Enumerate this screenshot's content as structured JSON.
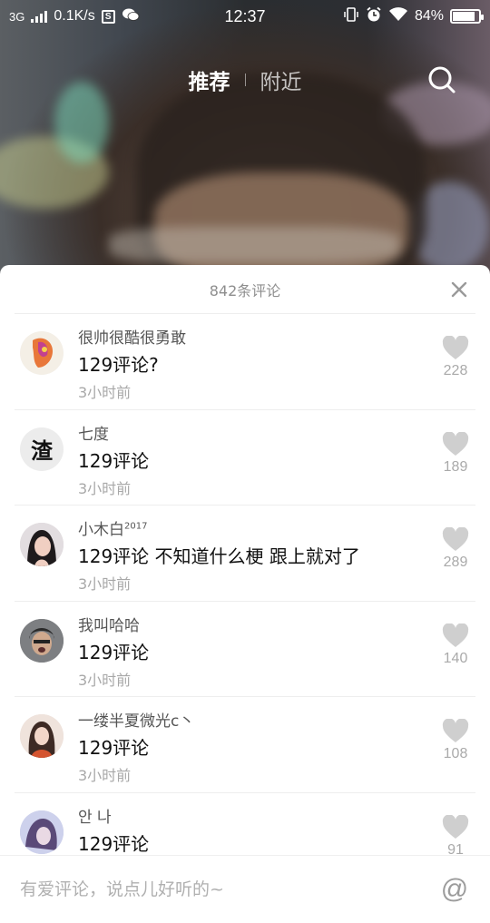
{
  "status_bar": {
    "network": "3G",
    "speed": "0.1K/s",
    "time": "12:37",
    "battery": "84%",
    "battery_level": 0.84,
    "icons": [
      "signal-icon",
      "s-box-icon",
      "wechat-icon",
      "vibrate-icon",
      "alarm-icon",
      "wifi-icon",
      "battery-icon"
    ]
  },
  "tabs": [
    {
      "label": "推荐",
      "active": true
    },
    {
      "label": "附近",
      "active": false
    }
  ],
  "comments_panel": {
    "title": "842条评论",
    "input_placeholder": "有爱评论，说点儿好听的~",
    "at_symbol": "@"
  },
  "comments": [
    {
      "username": "很帅很酷很勇敢",
      "sup": "",
      "text": "129评论?",
      "time": "3小时前",
      "likes": "228",
      "avatar": "orange-art"
    },
    {
      "username": "七度",
      "sup": "",
      "text": "129评论",
      "time": "3小时前",
      "likes": "189",
      "avatar": "text",
      "avatar_text": "渣"
    },
    {
      "username": "小木白",
      "sup": "2017",
      "text": "129评论 不知道什么梗 跟上就对了",
      "time": "3小时前",
      "likes": "289",
      "avatar": "girl-dark"
    },
    {
      "username": "我叫哈哈",
      "sup": "",
      "text": "129评论",
      "time": "3小时前",
      "likes": "140",
      "avatar": "man-shout"
    },
    {
      "username": "一缕半夏微光c丶",
      "sup": "",
      "text": "129评论",
      "time": "3小时前",
      "likes": "108",
      "avatar": "girl-red"
    },
    {
      "username": "안 나",
      "sup": "",
      "text": "129评论",
      "time": "",
      "likes": "91",
      "avatar": "girl-blue"
    }
  ],
  "colors": {
    "heart": "#cfcfcf",
    "muted_text": "#a8a8a8"
  }
}
